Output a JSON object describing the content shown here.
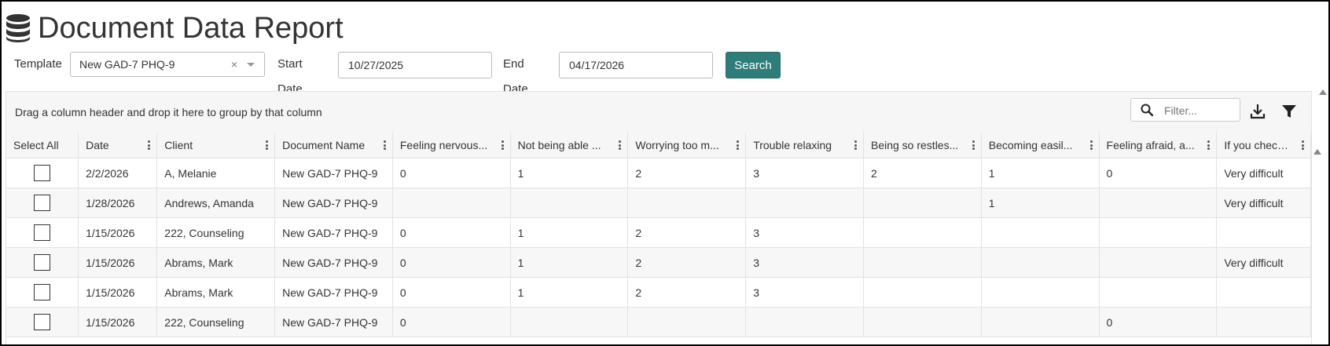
{
  "page": {
    "title": "Document Data Report",
    "title_icon": "database-icon"
  },
  "filters": {
    "template_label": "Template",
    "template_value": "New GAD-7 PHQ-9",
    "clear_glyph": "×",
    "start_label": "Start Date",
    "start_value": "10/27/2025",
    "end_label": "End Date",
    "end_value": "04/17/2026",
    "search_label": "Search"
  },
  "grid": {
    "group_hint": "Drag a column header and drop it here to group by that column",
    "filter_placeholder": "Filter...",
    "columns": [
      "Select All",
      "Date",
      "Client",
      "Document Name",
      "Feeling nervous...",
      "Not being able ...",
      "Worrying too m...",
      "Trouble relaxing",
      "Being so restles...",
      "Becoming easil...",
      "Feeling afraid, a...",
      "If you checked ..."
    ],
    "rows": [
      [
        "2/2/2026",
        "A, Melanie",
        "New GAD-7 PHQ-9",
        "0",
        "1",
        "2",
        "3",
        "2",
        "1",
        "0",
        "Very difficult"
      ],
      [
        "1/28/2026",
        "Andrews, Amanda",
        "New GAD-7 PHQ-9",
        "",
        "",
        "",
        "",
        "",
        "1",
        "",
        "Very difficult"
      ],
      [
        "1/15/2026",
        "222, Counseling",
        "New GAD-7 PHQ-9",
        "0",
        "1",
        "2",
        "3",
        "",
        "",
        "",
        ""
      ],
      [
        "1/15/2026",
        "Abrams, Mark",
        "New GAD-7 PHQ-9",
        "0",
        "1",
        "2",
        "3",
        "",
        "",
        "",
        "Very difficult"
      ],
      [
        "1/15/2026",
        "Abrams, Mark",
        "New GAD-7 PHQ-9",
        "0",
        "1",
        "2",
        "3",
        "",
        "",
        "",
        ""
      ],
      [
        "1/15/2026",
        "222, Counseling",
        "New GAD-7 PHQ-9",
        "0",
        "",
        "",
        "",
        "",
        "",
        "0",
        ""
      ]
    ]
  },
  "colors": {
    "accent": "#2e7d7a",
    "text": "#333333",
    "header_bg": "#f6f6f6"
  }
}
